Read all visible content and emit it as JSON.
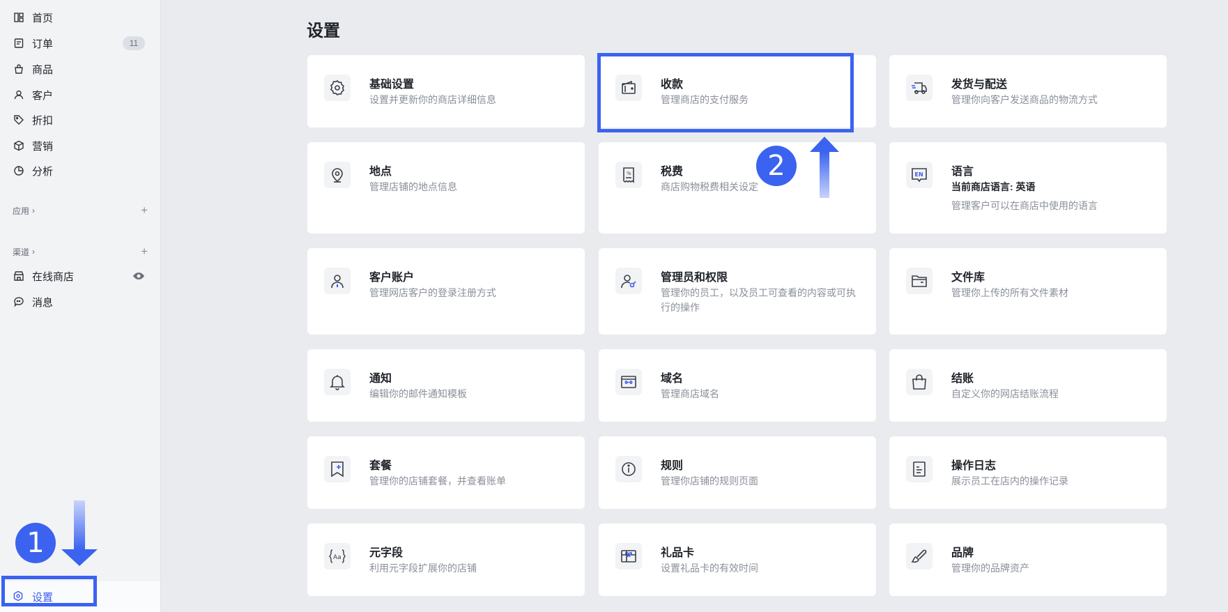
{
  "sidebar": {
    "items": [
      {
        "label": "首页",
        "icon": "dashboard-icon"
      },
      {
        "label": "订单",
        "icon": "order-icon",
        "badge": "11"
      },
      {
        "label": "商品",
        "icon": "bag-icon"
      },
      {
        "label": "客户",
        "icon": "user-icon"
      },
      {
        "label": "折扣",
        "icon": "tag-icon"
      },
      {
        "label": "营销",
        "icon": "box-icon"
      },
      {
        "label": "分析",
        "icon": "pie-chart-icon"
      }
    ],
    "apps_label": "应用",
    "channels_label": "渠道",
    "channel_items": [
      {
        "label": "在线商店",
        "icon": "store-icon"
      },
      {
        "label": "消息",
        "icon": "chat-icon"
      }
    ],
    "settings_label": "设置"
  },
  "main": {
    "title": "设置",
    "cards": [
      {
        "title": "基础设置",
        "desc": "设置并更新你的商店详细信息",
        "icon": "gear-icon"
      },
      {
        "title": "收款",
        "desc": "管理商店的支付服务",
        "icon": "wallet-icon"
      },
      {
        "title": "发货与配送",
        "desc": "管理你向客户发送商品的物流方式",
        "icon": "truck-icon"
      },
      {
        "title": "地点",
        "desc": "管理店铺的地点信息",
        "icon": "location-pin-icon"
      },
      {
        "title": "税费",
        "desc": "商店购物税费相关设定",
        "icon": "tax-receipt-icon"
      },
      {
        "title": "语言",
        "desc": "当前商店语言: 英语",
        "desc2": "管理客户可以在商店中使用的语言",
        "icon": "language-en-icon"
      },
      {
        "title": "客户账户",
        "desc": "管理网店客户的登录注册方式",
        "icon": "customer-account-icon"
      },
      {
        "title": "管理员和权限",
        "desc": "管理你的员工，以及员工可查看的内容或可执行的操作",
        "icon": "admin-key-icon"
      },
      {
        "title": "文件库",
        "desc": "管理你上传的所有文件素材",
        "icon": "folder-icon"
      },
      {
        "title": "通知",
        "desc": "编辑你的邮件通知模板",
        "icon": "bell-icon"
      },
      {
        "title": "域名",
        "desc": "管理商店域名",
        "icon": "domain-link-icon"
      },
      {
        "title": "结账",
        "desc": "自定义你的网店结账流程",
        "icon": "shopping-bag-icon"
      },
      {
        "title": "套餐",
        "desc": "管理你的店铺套餐，并查看账单",
        "icon": "plan-bookmark-icon"
      },
      {
        "title": "规则",
        "desc": "管理你店铺的规则页面",
        "icon": "info-icon"
      },
      {
        "title": "操作日志",
        "desc": "展示员工在店内的操作记录",
        "icon": "log-document-icon"
      },
      {
        "title": "元字段",
        "desc": "利用元字段扩展你的店铺",
        "icon": "metafield-icon"
      },
      {
        "title": "礼品卡",
        "desc": "设置礼品卡的有效时间",
        "icon": "gift-card-icon"
      },
      {
        "title": "品牌",
        "desc": "管理你的品牌资产",
        "icon": "brand-brush-icon"
      }
    ]
  },
  "annotations": {
    "step1": "1",
    "step2": "2",
    "accent_color": "#3a63f0"
  }
}
